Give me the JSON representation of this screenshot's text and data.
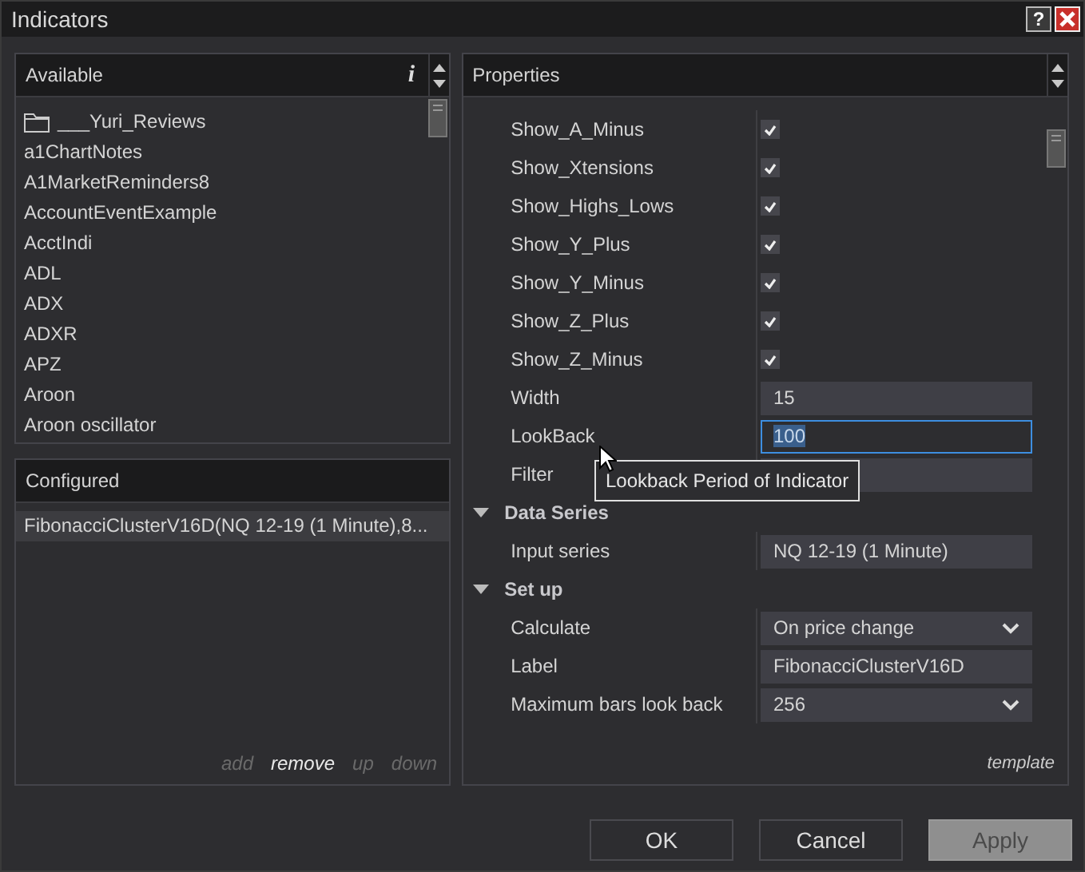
{
  "window": {
    "title": "Indicators",
    "help": "?"
  },
  "available": {
    "title": "Available",
    "info": "i",
    "items": [
      {
        "label": "___Yuri_Reviews",
        "kind": "folder"
      },
      {
        "label": "a1ChartNotes",
        "kind": "indicator"
      },
      {
        "label": "A1MarketReminders8",
        "kind": "indicator"
      },
      {
        "label": "AccountEventExample",
        "kind": "indicator"
      },
      {
        "label": "AcctIndi",
        "kind": "indicator"
      },
      {
        "label": "ADL",
        "kind": "indicator"
      },
      {
        "label": "ADX",
        "kind": "indicator"
      },
      {
        "label": "ADXR",
        "kind": "indicator"
      },
      {
        "label": "APZ",
        "kind": "indicator"
      },
      {
        "label": "Aroon",
        "kind": "indicator"
      },
      {
        "label": "Aroon oscillator",
        "kind": "indicator"
      }
    ]
  },
  "configured": {
    "title": "Configured",
    "items": [
      {
        "label": "FibonacciClusterV16D(NQ 12-19 (1 Minute),8...",
        "selected": true
      }
    ],
    "actions": [
      {
        "label": "add",
        "disabled": true
      },
      {
        "label": "remove",
        "disabled": false
      },
      {
        "label": "up",
        "disabled": true
      },
      {
        "label": "down",
        "disabled": true
      }
    ]
  },
  "properties": {
    "title": "Properties",
    "sections": [
      {
        "rows": [
          {
            "label": "Show_A_Minus",
            "kind": "checkbox",
            "checked": true
          },
          {
            "label": "Show_Xtensions",
            "kind": "checkbox",
            "checked": true
          },
          {
            "label": "Show_Highs_Lows",
            "kind": "checkbox",
            "checked": true
          },
          {
            "label": "Show_Y_Plus",
            "kind": "checkbox",
            "checked": true
          },
          {
            "label": "Show_Y_Minus",
            "kind": "checkbox",
            "checked": true
          },
          {
            "label": "Show_Z_Plus",
            "kind": "checkbox",
            "checked": true
          },
          {
            "label": "Show_Z_Minus",
            "kind": "checkbox",
            "checked": true
          },
          {
            "label": "Width",
            "kind": "text",
            "value": "15",
            "focused": false
          },
          {
            "label": "LookBack",
            "kind": "text",
            "value": "100",
            "focused": true
          },
          {
            "label": "Filter",
            "kind": "text",
            "focused": false
          }
        ]
      },
      {
        "title": "Data Series",
        "expanded": true,
        "rows": [
          {
            "label": "Input series",
            "kind": "text",
            "value": "NQ 12-19 (1 Minute)",
            "focused": false
          }
        ]
      },
      {
        "title": "Set up",
        "expanded": true,
        "rows": [
          {
            "label": "Calculate",
            "kind": "dropdown",
            "value": "On price change"
          },
          {
            "label": "Label",
            "kind": "text",
            "value": "FibonacciClusterV16D",
            "focused": false
          },
          {
            "label": "Maximum bars look back",
            "kind": "dropdown",
            "value": "256"
          }
        ]
      }
    ],
    "footer": "template"
  },
  "tooltip": {
    "text": "Lookback Period of Indicator"
  },
  "buttons": [
    {
      "label": "OK",
      "disabled": false
    },
    {
      "label": "Cancel",
      "disabled": false
    },
    {
      "label": "Apply",
      "disabled": true
    }
  ]
}
